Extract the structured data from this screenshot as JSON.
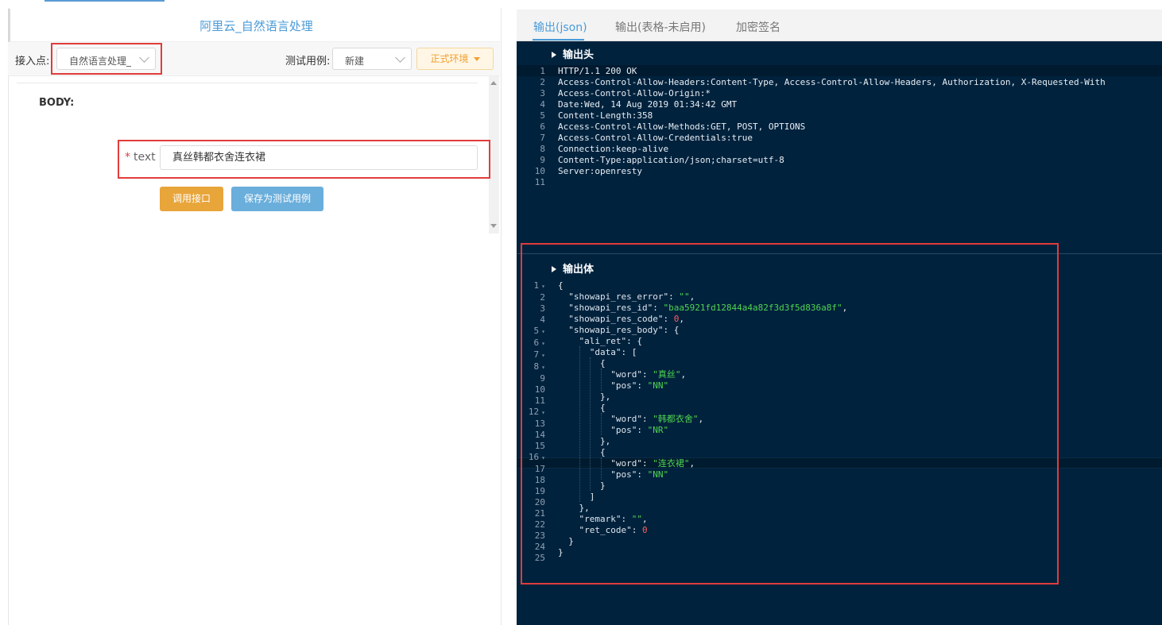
{
  "left": {
    "title": "阿里云_自然语言处理",
    "access_point_label": "接入点:",
    "access_point_value": "自然语言处理_",
    "test_case_label": "测试用例:",
    "test_case_value": "新建",
    "env_button": "正式环境",
    "body_label": "BODY:",
    "param_star": "*",
    "param_name": "text",
    "param_value": "真丝韩都衣舍连衣裙",
    "invoke_button": "调用接口",
    "save_case_button": "保存为测试用例"
  },
  "right": {
    "tabs": [
      "输出(json)",
      "输出(表格-未启用)",
      "加密签名"
    ],
    "active_tab": "输出(json)",
    "header_section_title": "输出头",
    "header_lines": [
      "HTTP/1.1 200 OK",
      "Access-Control-Allow-Headers:Content-Type, Access-Control-Allow-Headers, Authorization, X-Requested-With",
      "Access-Control-Allow-Origin:*",
      "Date:Wed, 14 Aug 2019 01:34:42 GMT",
      "Content-Length:358",
      "Access-Control-Allow-Methods:GET, POST, OPTIONS",
      "Access-Control-Allow-Credentials:true",
      "Connection:keep-alive",
      "Content-Type:application/json;charset=utf-8",
      "Server:openresty",
      ""
    ],
    "body_section_title": "输出体",
    "body_lines": [
      "{",
      "  \"showapi_res_error\": \"\",",
      "  \"showapi_res_id\": \"baa5921fd12844a4a82f3d3f5d836a8f\",",
      "  \"showapi_res_code\": 0,",
      "  \"showapi_res_body\": {",
      "    \"ali_ret\": {",
      "      \"data\": [",
      "        {",
      "          \"word\": \"真丝\",",
      "          \"pos\": \"NN\"",
      "        },",
      "        {",
      "          \"word\": \"韩都衣舍\",",
      "          \"pos\": \"NR\"",
      "        },",
      "        {",
      "          \"word\": \"连衣裙\",",
      "          \"pos\": \"NN\"",
      "        }",
      "      ]",
      "    },",
      "    \"remark\": \"\",",
      "    \"ret_code\": 0",
      "  }",
      "}"
    ],
    "fold_markers_at_lines": [
      1,
      5,
      6,
      7,
      8,
      12,
      16
    ],
    "highlighted_body_line": 17
  },
  "colors": {
    "accent_blue": "#4a9bd8",
    "editor_bg": "#00223d",
    "string_green": "#4fd44f",
    "number_red": "#ff5d5d",
    "highlight_red_box": "#e13c3c",
    "env_orange": "#f0a030",
    "invoke_button": "#e8a53a",
    "save_button": "#6aaedc"
  }
}
